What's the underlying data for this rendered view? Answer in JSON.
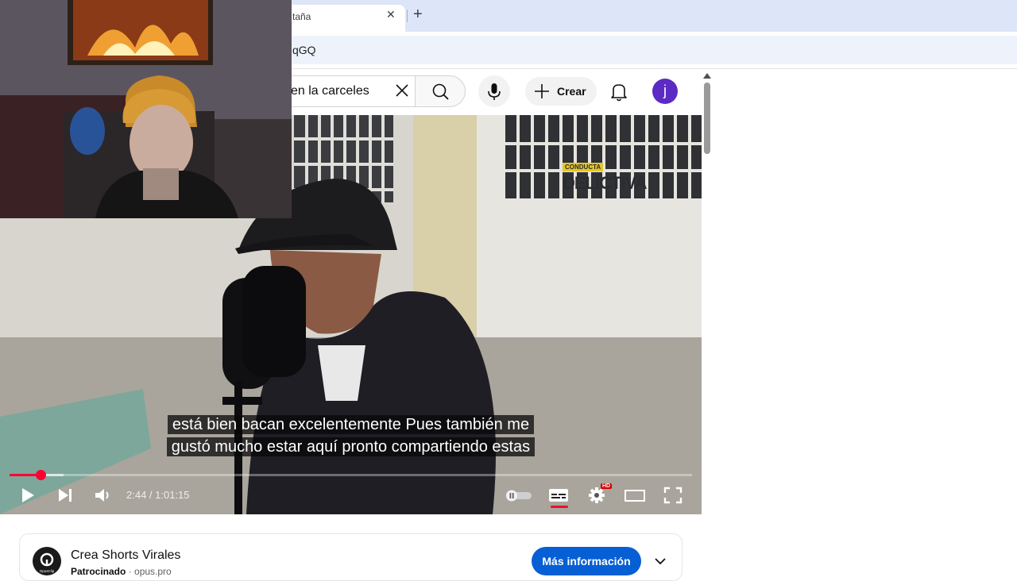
{
  "browser": {
    "tab_title": "taña",
    "tab_close": "✕",
    "new_tab": "+",
    "url_fragment": "qGQ"
  },
  "header": {
    "search_query": "en la carceles",
    "create_label": "Crear",
    "avatar_letter": "j"
  },
  "player": {
    "watermark_small": "CONDUCTA",
    "watermark_big": "DELICTIVA",
    "caption_line1": "está bien bacan excelentemente Pues también me",
    "caption_line2": "gustó mucho estar aquí pronto compartiendo estas",
    "time": "2:44 / 1:01:15",
    "hd_badge": "HD",
    "progress": 0.045
  },
  "ad": {
    "title": "Crea Shorts Virales",
    "sponsored": "Patrocinado",
    "separator": " · ",
    "domain": "opus.pro",
    "logo_text": "OpusClip",
    "cta": "Más información"
  },
  "colors": {
    "accent_red": "#ff0033",
    "avatar_purple": "#5c2bc4",
    "cta_blue": "#065fd4"
  }
}
